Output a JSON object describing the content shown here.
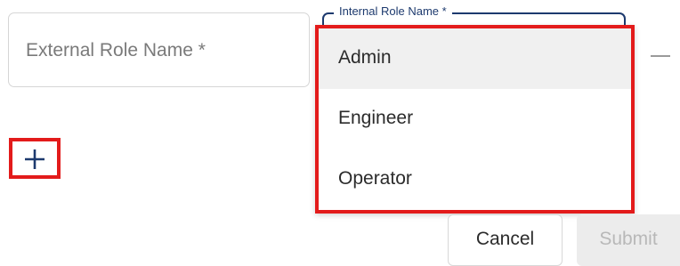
{
  "external_role": {
    "placeholder": "External Role Name *"
  },
  "internal_role": {
    "label": "Internal Role Name *",
    "options": [
      "Admin",
      "Engineer",
      "Operator"
    ],
    "highlighted_option": "Admin"
  },
  "icons": {
    "add": "plus-icon",
    "remove": "minus-icon"
  },
  "footer": {
    "cancel_label": "Cancel",
    "submit_label": "Submit",
    "submit_disabled": true
  },
  "colors": {
    "accent": "#1d3a6e",
    "highlight": "#e31b1b",
    "disabled_text": "#b8b8b8"
  }
}
